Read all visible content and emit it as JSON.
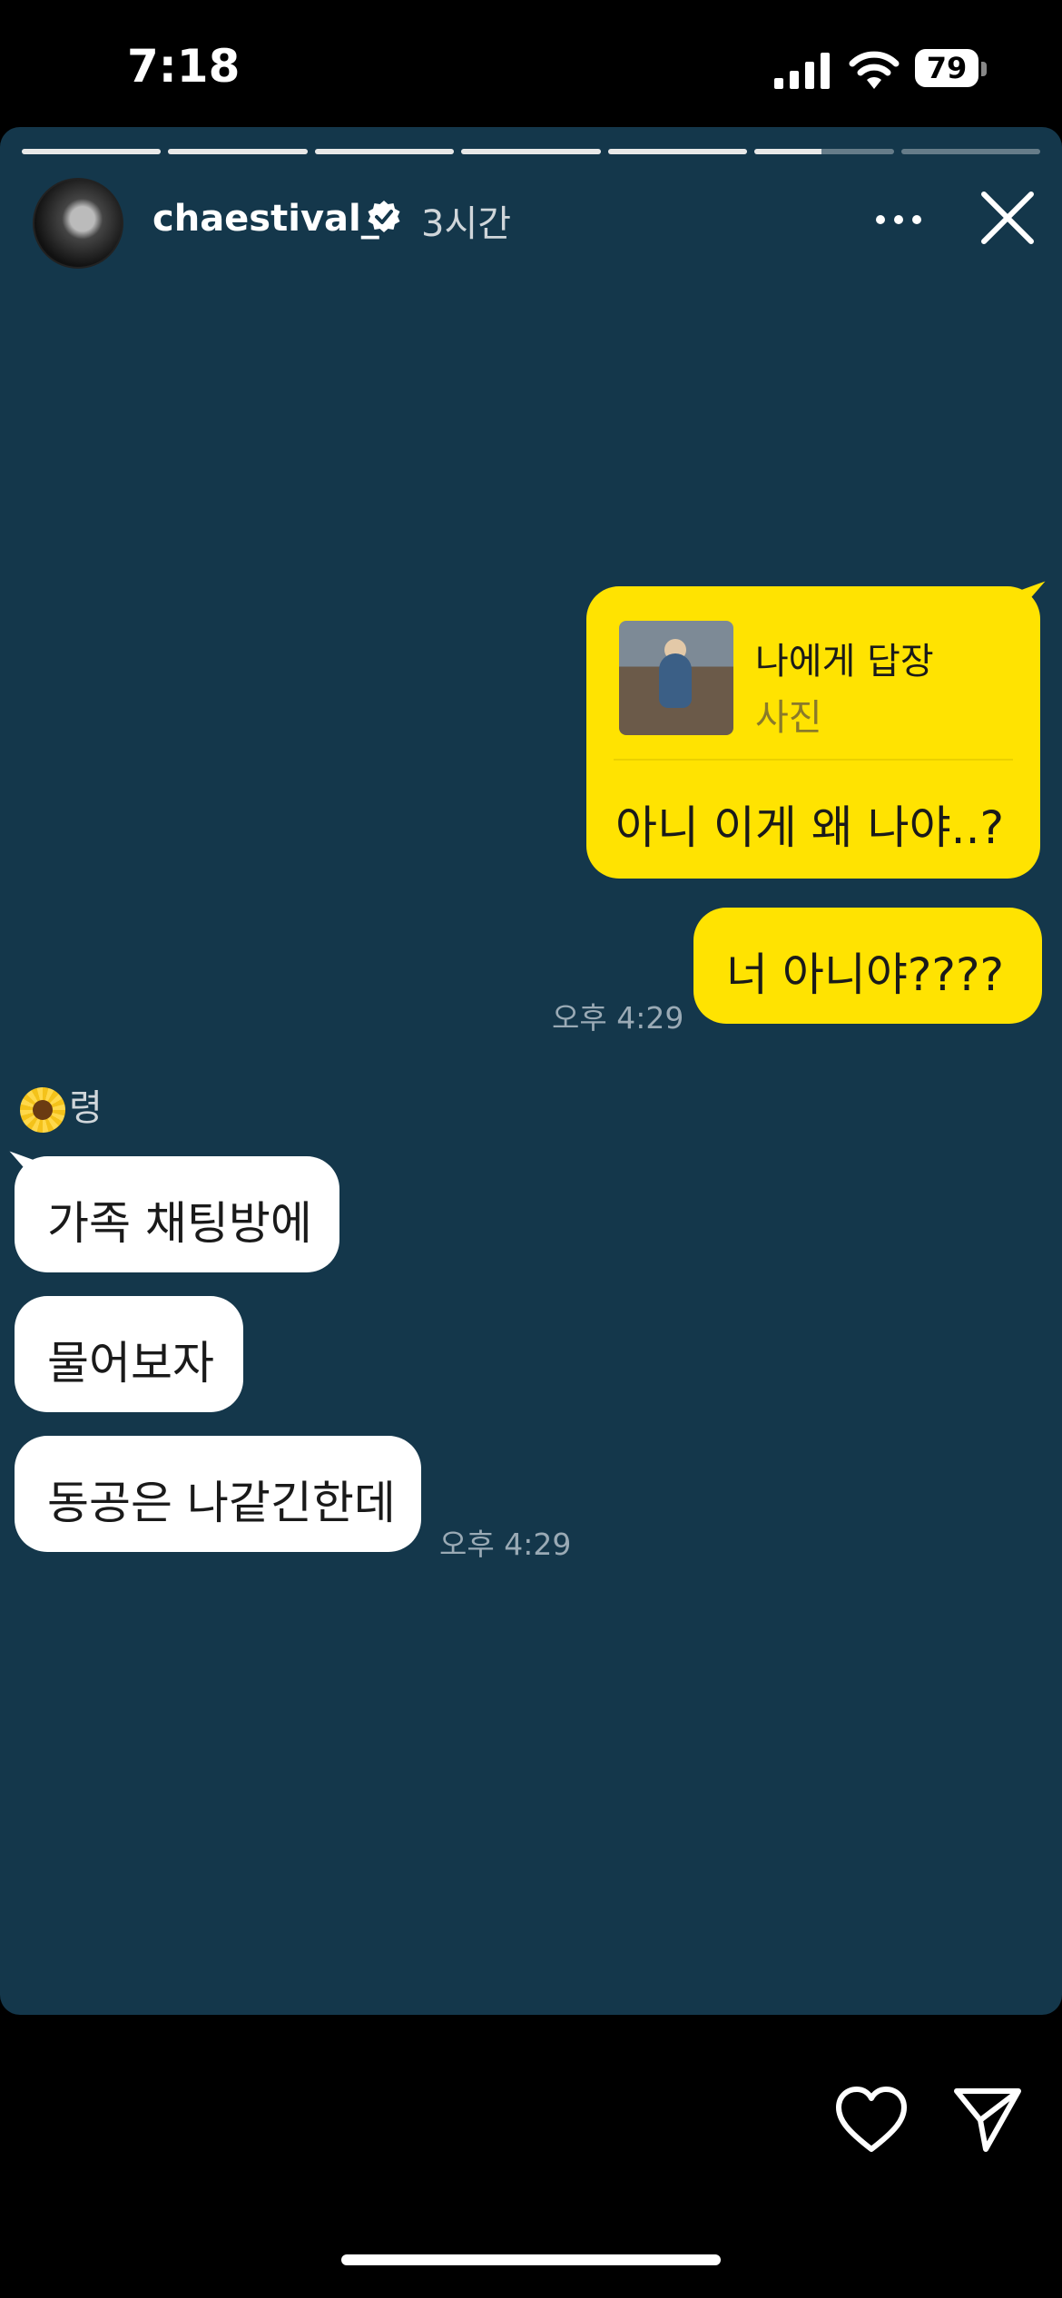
{
  "status_bar": {
    "time": "7:18",
    "battery": "79"
  },
  "story": {
    "progress": [
      1,
      1,
      1,
      1,
      1,
      0.48,
      0
    ],
    "username": "chaestival_",
    "time_ago": "3시간",
    "icons": [
      "more-icon",
      "close-icon",
      "verified-icon",
      "heart-icon",
      "send-icon"
    ]
  },
  "chat": {
    "reply_card": {
      "title": "나에게 답장",
      "subtitle": "사진",
      "text": "아니 이게 왜 나야..?"
    },
    "my_message": "너 아니야????",
    "my_timestamp": "오후 4:29",
    "sender_name": "령",
    "their_messages": [
      "가족 채팅방에",
      "물어보자",
      "동공은 나같긴한데"
    ],
    "their_timestamp": "오후 4:29"
  },
  "colors": {
    "story_bg": "#14374b",
    "my_bubble": "#ffe301",
    "their_bubble": "#ffffff"
  }
}
